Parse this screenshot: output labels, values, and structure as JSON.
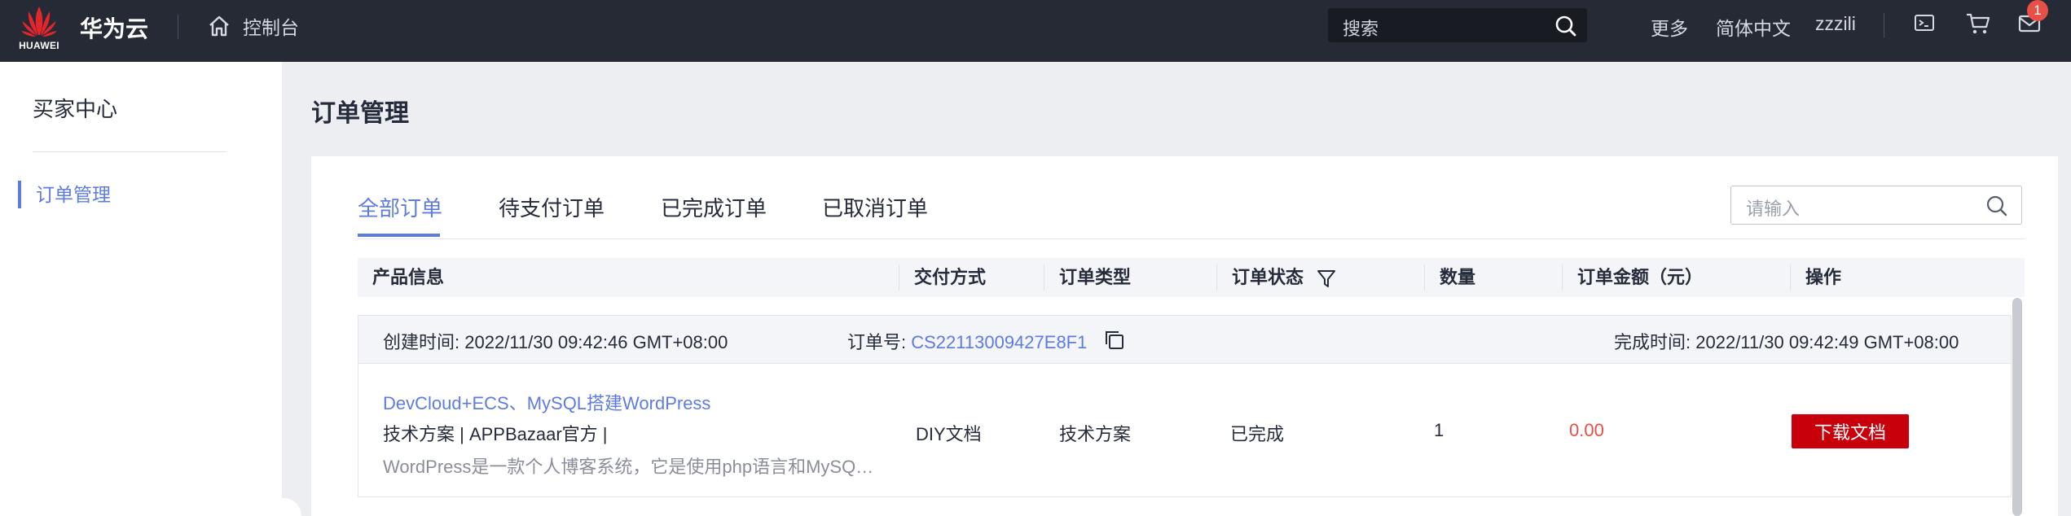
{
  "topbar": {
    "logo_text": "HUAWEI",
    "brand": "华为云",
    "console_label": "控制台",
    "search_placeholder": "搜索",
    "more": "更多",
    "language": "简体中文",
    "username": "zzzili",
    "message_count": "1"
  },
  "sidebar": {
    "title": "买家中心",
    "items": [
      {
        "label": "订单管理",
        "active": true
      }
    ]
  },
  "page": {
    "title": "订单管理",
    "tabs": [
      "全部订单",
      "待支付订单",
      "已完成订单",
      "已取消订单"
    ],
    "active_tab": "全部订单",
    "filter_placeholder": "请输入"
  },
  "table": {
    "columns": [
      "产品信息",
      "交付方式",
      "订单类型",
      "订单状态",
      "数量",
      "订单金额（元）",
      "操作"
    ],
    "orders": [
      {
        "created_label": "创建时间:",
        "created_time": "2022/11/30 09:42:46 GMT+08:00",
        "order_no_label": "订单号:",
        "order_no": "CS22113009427E8F1",
        "completed_label": "完成时间:",
        "completed_time": "2022/11/30 09:42:49 GMT+08:00",
        "product_name": "DevCloud+ECS、MySQL搭建WordPress",
        "product_tags": "技术方案 | APPBazaar官方 |",
        "product_desc": "WordPress是一款个人博客系统，它是使用php语言和MySQL数据库开发的",
        "delivery": "DIY文档",
        "type": "技术方案",
        "status": "已完成",
        "quantity": "1",
        "amount": "0.00",
        "action": "下载文档"
      }
    ]
  },
  "colors": {
    "topbar_bg": "#252a35",
    "accent": "#5e7ce0",
    "price": "#e84f47",
    "button": "#c7000b"
  }
}
